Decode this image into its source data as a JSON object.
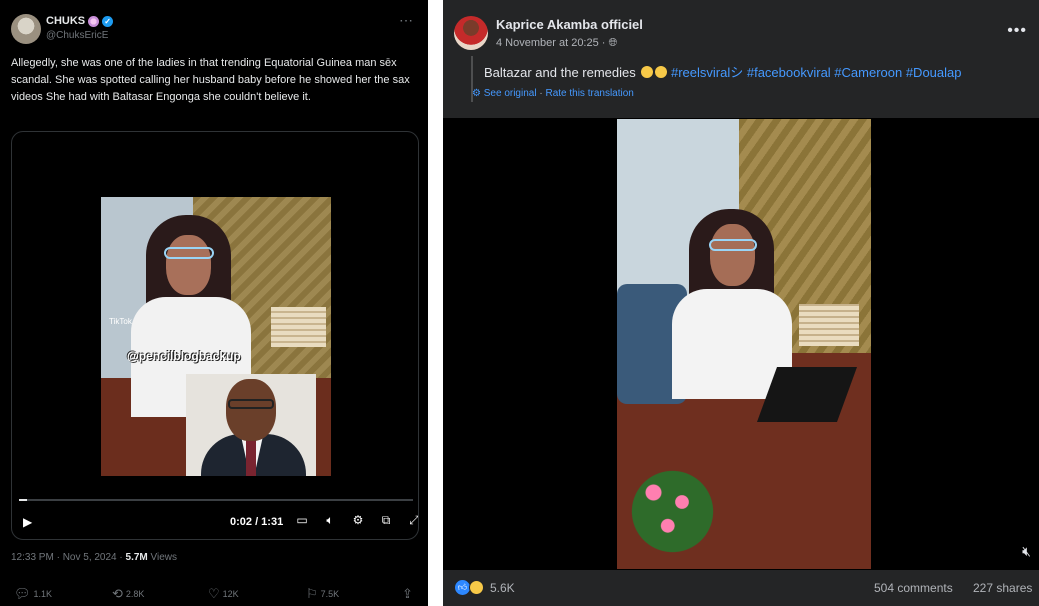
{
  "twitter": {
    "display_name": "CHUKS",
    "handle": "@ChuksEricE",
    "more_icon": "⋯",
    "text": "Allegedly, she was one of the ladies in that trending Equatorial Guinea man sēx scandal. She was spotted calling her husband baby before he showed her the sax videos She had with Baltasar Engonga she couldn't believe it.",
    "video": {
      "watermark": "@pencilblogbackup",
      "tiktok_label": "TikTok",
      "time": "0:02 / 1:31",
      "progress": 0.02
    },
    "meta": {
      "timestamp": "12:33 PM · Nov 5, 2024 · ",
      "views_count": "5.7M",
      "views_label": " Views"
    },
    "actions": {
      "replies": "1.1K",
      "reposts": "2.8K",
      "likes": "12K",
      "bookmarks": "7.5K"
    }
  },
  "facebook": {
    "page_name": "Kaprice Akamba officiel",
    "date": "4 November at 20:25 · ",
    "caption_text": "Baltazar and the remedies ",
    "hashtags": "#reelsviralシ #facebookviral #Cameroon #Doualap",
    "see_original": "See original",
    "rate_translation": "Rate this translation",
    "reactions_count": "5.6K",
    "comments": "504 comments",
    "shares": "227 shares"
  },
  "colors": {
    "twitter_blue": "#1d9bf0",
    "facebook_blue": "#2d88ff",
    "link_blue": "#4599ff"
  }
}
